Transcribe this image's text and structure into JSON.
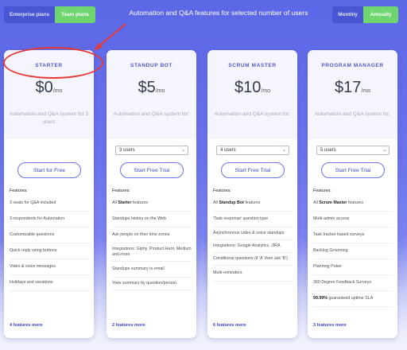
{
  "header": {
    "plan_toggle": {
      "option1": "Enterprise plans",
      "option2": "Team plans"
    },
    "headline": "Automation and Q&A features for selected number of users",
    "billing_toggle": {
      "option1": "Monthly",
      "option2": "Annually"
    }
  },
  "colors": {
    "accent": "#5157c9",
    "toggle_active": "#6fd66f",
    "background": "#5c67e6",
    "highlight": "#e53935"
  },
  "cards": [
    {
      "title": "STARTER",
      "price": "$0",
      "per": "/mo",
      "desc": "Automation and Q&A system for 3 users",
      "cta": "Start for Free",
      "features_label": "Features:",
      "features": [
        "3 seats for Q&A included",
        "3 respondents for Automation",
        "Customizable questions",
        "Quick reply using buttons",
        "Video & voice messages",
        "Holidays and vacations"
      ],
      "more": "4 features more"
    },
    {
      "title": "STANDUP BOT",
      "price": "$5",
      "per": "/mo",
      "desc": "Automation and Q&A system for:",
      "select": "3 users",
      "cta": "Start Free Trial",
      "features_label": "Features:",
      "features": [
        {
          "pre": "All ",
          "bold": "Starter",
          "post": " features"
        },
        "Standups history on the Web",
        "Ask people on their time zones",
        "Integrations: Giphy, Product Hunt, Medium and more",
        "Standups summary to email",
        "View summary by question/person"
      ],
      "more": "2 features more"
    },
    {
      "title": "SCRUM MASTER",
      "price": "$10",
      "per": "/mo",
      "desc": "Automation and Q&A system for:",
      "select": "4 users",
      "cta": "Start Free Trial",
      "features_label": "Features:",
      "features": [
        {
          "pre": "All ",
          "bold": "Standup Bot",
          "post": " features"
        },
        "'Task response' question type",
        "Asynchronous video & voice standups",
        "Integrations: Google Analytics, JIRA",
        "Conditional questions (if 'A' then ask 'B')",
        "Multi-reminders"
      ],
      "more": "6 features more"
    },
    {
      "title": "PROGRAM MANAGER",
      "price": "$17",
      "per": "/mo",
      "desc": "Automation and Q&A system for:",
      "select": "5 users",
      "cta": "Start Free Trial",
      "features_label": "Features:",
      "features": [
        {
          "pre": "All ",
          "bold": "Scrum Master",
          "post": " features"
        },
        "Multi-admin access",
        "Task tracker based surveys",
        "Backlog Grooming",
        "Planning Poker",
        "360 Degree Feedback Surveys",
        {
          "pre": "",
          "bold": "99.99%",
          "post": " guaranteed uptime SLA"
        }
      ],
      "more": "3 features more"
    }
  ]
}
